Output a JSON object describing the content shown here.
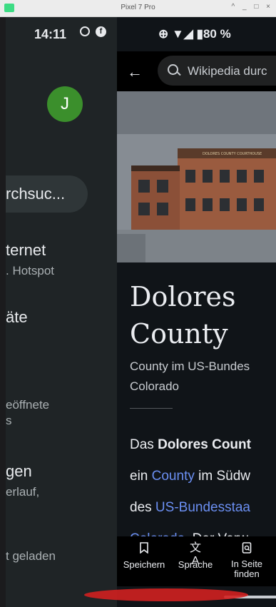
{
  "window": {
    "title": "Pixel 7 Pro",
    "controls": "^ _ □ ×"
  },
  "drawer": {
    "time": "14:11",
    "avatar_letter": "J",
    "search_fragment": "rchsuc...",
    "items": [
      {
        "title": "ternet",
        "subtitle": ". Hotspot"
      },
      {
        "title": "äte",
        "subtitle": ""
      },
      {
        "title": "",
        "subtitle": "eöffnete"
      },
      {
        "title": "",
        "subtitle": "s"
      },
      {
        "title": "gen",
        "subtitle": "erlauf,"
      },
      {
        "title": "",
        "subtitle": "t geladen"
      }
    ]
  },
  "wiki": {
    "status_text": "⊕ ▼◢ ▮80 %",
    "search_placeholder": "Wikipedia durc",
    "title_line1": "Dolores",
    "title_line2": "County",
    "description_line1": "County im US-Bundes",
    "description_line2": "Colorado",
    "body": {
      "l1_pre": "Das ",
      "l1_bold": "Dolores Count",
      "l2_pre": "ein ",
      "l2_link": "County",
      "l2_post": " im Südw",
      "l3_pre": "des ",
      "l3_link": "US-Bundesstaa",
      "l4_link": "Colorado",
      "l4_post": ". Der Verw"
    },
    "bottom_nav": [
      {
        "label": "Speichern",
        "icon": "bookmark-icon"
      },
      {
        "label": "Sprache",
        "icon": "translate-icon"
      },
      {
        "label": "In Seite finden",
        "icon": "find-in-page-icon"
      }
    ],
    "image_alt": "DOLORES COUNTY COURTHOUSE"
  }
}
